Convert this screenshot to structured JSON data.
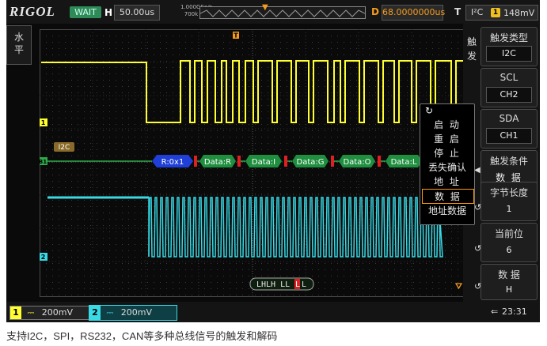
{
  "topbar": {
    "brand": "RIGOL",
    "run_state": "WAIT",
    "horizontal_label": "H",
    "timebase": "50.00us",
    "sample_rate": "1.000GSa/s",
    "memory_depth": "700k pts",
    "delay_label": "D",
    "delay_value": "68.0000000us",
    "trigger_label": "T",
    "trigger_type_short": "I²C",
    "trigger_level": "148mV",
    "trigger_channel_badge": "1"
  },
  "left_panel": {
    "chars": [
      "水",
      "平"
    ]
  },
  "waveform": {
    "ch1_marker": "1",
    "ch2_marker": "2",
    "bus_marker": "B1",
    "bus_label": "I2C",
    "trigger_position_marker": "T",
    "decode_packets": [
      "R:0x1",
      "Data:R",
      "Data:I",
      "Data:G",
      "Data:O",
      "Data:L"
    ],
    "pattern_readout": [
      "LHLH LL",
      "L",
      "L"
    ],
    "colors": {
      "ch1": "#ffff30",
      "ch2": "#39d9e5",
      "bus": "#2ea84a",
      "address": "#1f3fd8",
      "data": "#1f8f3f",
      "marker": "#e02020",
      "trigger": "#f59b1e"
    }
  },
  "popup_menu": {
    "items": [
      "启 动",
      "重 启",
      "停 止",
      "丢失确认",
      "地 址",
      "数 据",
      "地址数据"
    ],
    "selected": "数 据"
  },
  "right_menu": {
    "title_chars": [
      "触",
      "发"
    ],
    "buttons": [
      {
        "label": "触发类型",
        "value": "I2C"
      },
      {
        "label": "SCL",
        "value": "CH2"
      },
      {
        "label": "SDA",
        "value": "CH1"
      },
      {
        "label": "触发条件",
        "value": "数  据"
      },
      {
        "label": "字节长度",
        "value": "1"
      },
      {
        "label": "当前位",
        "value": "6"
      },
      {
        "label": "数  据",
        "value": "H"
      }
    ]
  },
  "bottom": {
    "ch1_number": "1",
    "ch1_scale": "200mV",
    "ch2_number": "2",
    "ch2_scale": "200mV",
    "time": "23:31"
  },
  "caption": "支持I2C，SPI，RS232，CAN等多种总线信号的触发和解码"
}
